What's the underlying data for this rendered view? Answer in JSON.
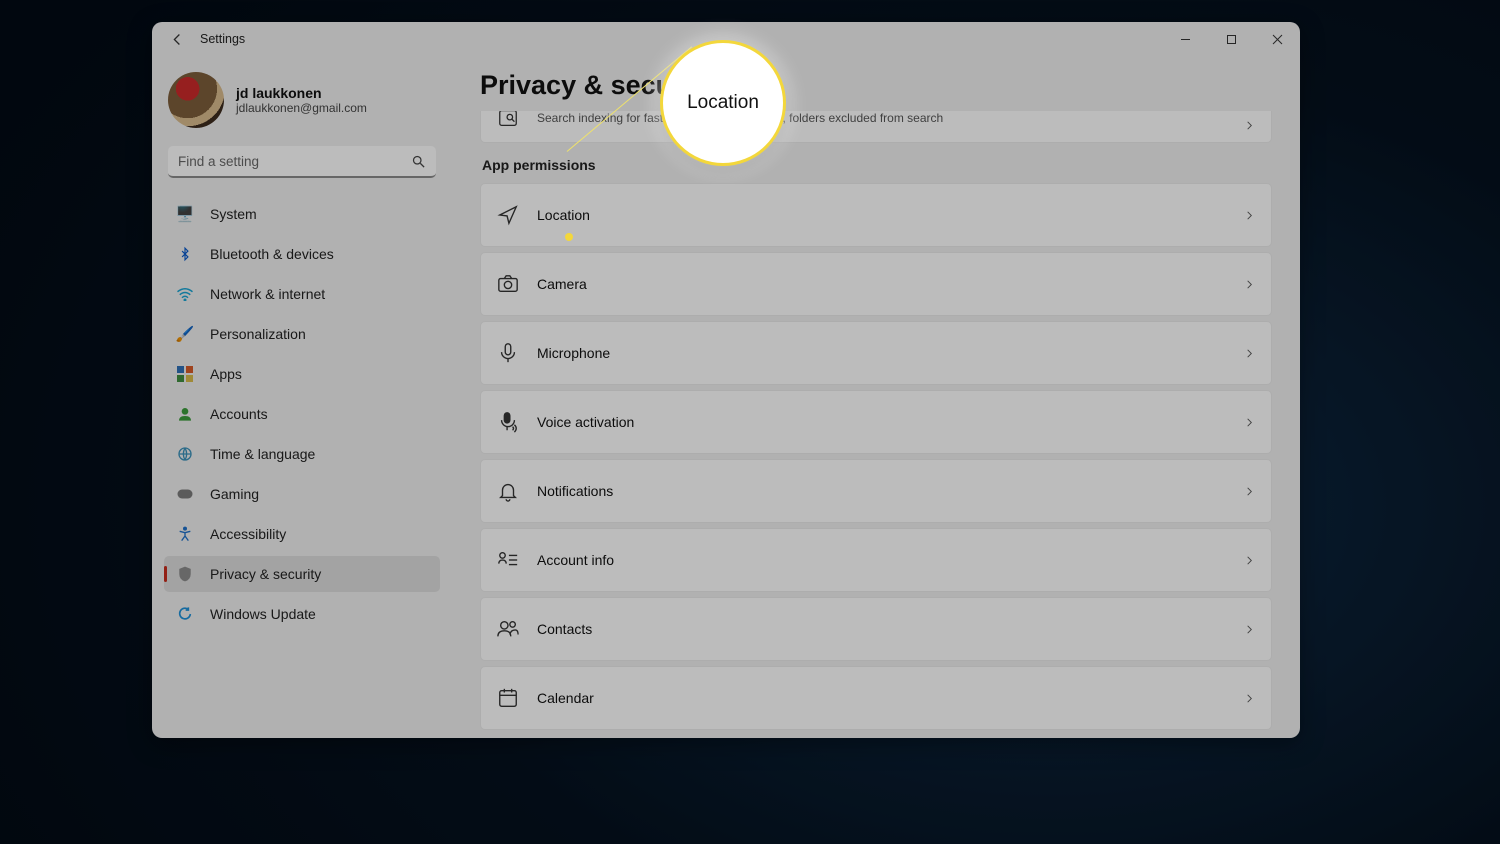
{
  "window": {
    "app_title": "Settings"
  },
  "user": {
    "name": "jd laukkonen",
    "email": "jdlaukkonen@gmail.com"
  },
  "search": {
    "placeholder": "Find a setting"
  },
  "sidebar": {
    "items": [
      {
        "label": "System"
      },
      {
        "label": "Bluetooth & devices"
      },
      {
        "label": "Network & internet"
      },
      {
        "label": "Personalization"
      },
      {
        "label": "Apps"
      },
      {
        "label": "Accounts"
      },
      {
        "label": "Time & language"
      },
      {
        "label": "Gaming"
      },
      {
        "label": "Accessibility"
      },
      {
        "label": "Privacy & security"
      },
      {
        "label": "Windows Update"
      }
    ]
  },
  "main": {
    "title": "Privacy & security",
    "search_card": {
      "sub": "Search indexing for faster results, find my files, folders excluded from search"
    },
    "section_label": "App permissions",
    "items": [
      {
        "label": "Location"
      },
      {
        "label": "Camera"
      },
      {
        "label": "Microphone"
      },
      {
        "label": "Voice activation"
      },
      {
        "label": "Notifications"
      },
      {
        "label": "Account info"
      },
      {
        "label": "Contacts"
      },
      {
        "label": "Calendar"
      }
    ]
  },
  "callout": {
    "text": "Location"
  }
}
